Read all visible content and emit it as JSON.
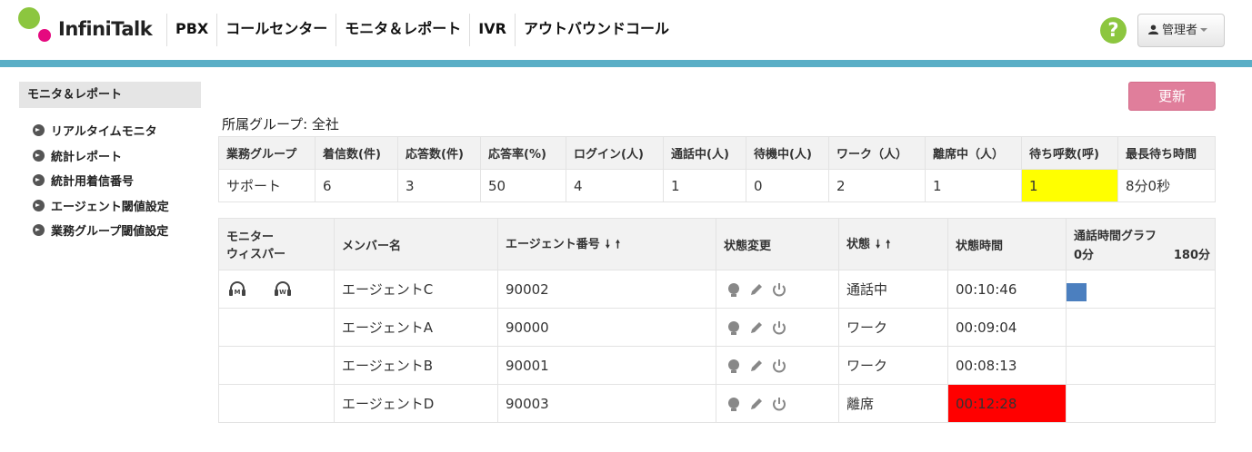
{
  "brand": {
    "name": "InfiniTalk"
  },
  "nav": [
    "PBX",
    "コールセンター",
    "モニタ＆レポート",
    "IVR",
    "アウトバウンドコール"
  ],
  "header": {
    "help_label": "?",
    "user_label": "管理者"
  },
  "sidebar": {
    "title": "モニタ＆レポート",
    "items": [
      {
        "label": "リアルタイムモニタ"
      },
      {
        "label": "統計レポート"
      },
      {
        "label": "統計用着信番号"
      },
      {
        "label": "エージェント閾値設定"
      },
      {
        "label": "業務グループ閾値設定"
      }
    ]
  },
  "refresh_label": "更新",
  "group_label": "所属グループ: 全社",
  "summary": {
    "headers": [
      "業務グループ",
      "着信数(件)",
      "応答数(件)",
      "応答率(%)",
      "ログイン(人)",
      "通話中(人)",
      "待機中(人)",
      "ワーク（人）",
      "離席中（人）",
      "待ち呼数(呼)",
      "最長待ち時間"
    ],
    "row": [
      "サポート",
      "6",
      "3",
      "50",
      "4",
      "1",
      "0",
      "2",
      "1",
      "1",
      "8分0秒"
    ],
    "highlight_color": "#ffff00"
  },
  "agents": {
    "headers": {
      "monitor_line1": "モニター",
      "monitor_line2": "ウィスパー",
      "name": "メンバー名",
      "number": "エージェント番号",
      "change": "状態変更",
      "status": "状態",
      "time": "状態時間",
      "graph": "通話時間グラフ",
      "graph_min": "0分",
      "graph_max": "180分"
    },
    "sort_down": "🠗",
    "sort_up": "🠕",
    "monitor_icons": [
      "monitor-headset-icon",
      "whisper-headset-icon"
    ],
    "rows": [
      {
        "name": "エージェントC",
        "number": "90002",
        "status": "通話中",
        "time": "00:10:46"
      },
      {
        "name": "エージェントA",
        "number": "90000",
        "status": "ワーク",
        "time": "00:09:04"
      },
      {
        "name": "エージェントB",
        "number": "90001",
        "status": "ワーク",
        "time": "00:08:13"
      },
      {
        "name": "エージェントD",
        "number": "90003",
        "status": "離席",
        "time": "00:12:28"
      }
    ],
    "alert_color": "#ff0000",
    "graph_color": "#4b7fbf"
  },
  "colors": {
    "accent_line": "#5aaec6",
    "refresh": "#e07e9b",
    "help": "#8cc63f"
  }
}
